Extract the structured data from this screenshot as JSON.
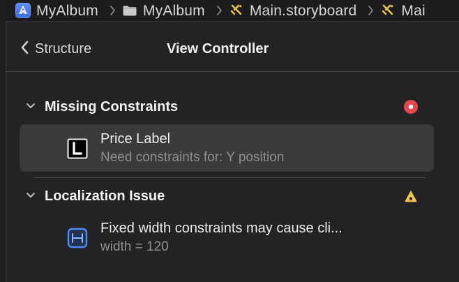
{
  "breadcrumb": {
    "items": [
      {
        "label": "MyAlbum",
        "icon": "app-icon"
      },
      {
        "label": "MyAlbum",
        "icon": "folder-icon"
      },
      {
        "label": "Main.storyboard",
        "icon": "storyboard-icon"
      },
      {
        "label": "Mai",
        "icon": "storyboard-icon"
      }
    ]
  },
  "header": {
    "back_label": "Structure",
    "title": "View Controller"
  },
  "sections": [
    {
      "title": "Missing Constraints",
      "status_icon": "error-icon",
      "status_color": "#e5484d",
      "items": [
        {
          "title": "Price Label",
          "subtitle": "Need constraints for: Y position",
          "icon": "label-icon",
          "selected": true
        }
      ]
    },
    {
      "title": "Localization Issue",
      "status_icon": "warning-icon",
      "status_color": "#f0c64a",
      "items": [
        {
          "title": "Fixed width constraints may cause cli...",
          "subtitle": "width = 120",
          "icon": "width-constraint-icon",
          "selected": false
        }
      ]
    }
  ],
  "colors": {
    "background": "#232325",
    "selected_row": "#3a3a3d",
    "accent_blue": "#4d8cf5",
    "text_primary": "#ececee",
    "text_secondary": "#8e8e93"
  }
}
